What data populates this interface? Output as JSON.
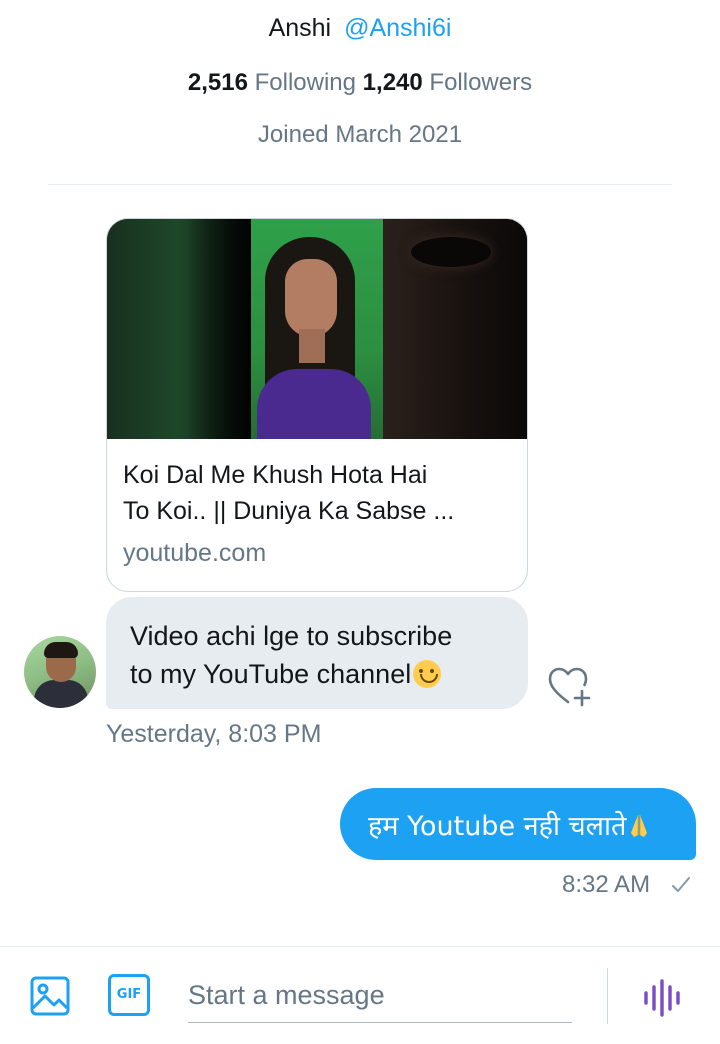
{
  "profile": {
    "name": "Anshi",
    "handle": "@Anshi6i",
    "following_count": "2,516",
    "following_label": "Following",
    "followers_count": "1,240",
    "followers_label": "Followers",
    "joined": "Joined March 2021"
  },
  "link_card": {
    "title_line1": "Koi Dal Me Khush Hota Hai",
    "title_line2": "To Koi.. || Duniya Ka Sabse ...",
    "domain": "youtube.com"
  },
  "received_message": {
    "line1": "Video achi lge to subscribe",
    "line2": "to my YouTube channel",
    "emoji": "smiling-face-emoji",
    "timestamp": "Yesterday, 8:03 PM"
  },
  "sent_message": {
    "text": "हम Youtube नही चलाते",
    "emoji": "folded-hands-emoji",
    "timestamp": "8:32 AM"
  },
  "composer": {
    "placeholder": "Start a message",
    "gif_label": "GIF"
  },
  "colors": {
    "accent": "#1da1f2",
    "secondary_text": "#657786",
    "received_bubble": "#e6ecf0",
    "voice_icon": "#794bc4"
  }
}
